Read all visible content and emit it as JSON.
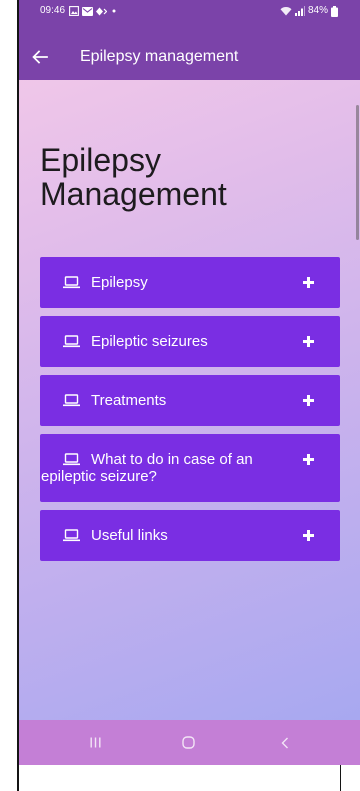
{
  "status_bar": {
    "time": "09:46",
    "battery_level": "84%",
    "left_icons": [
      "gallery-icon",
      "mail-icon",
      "status-app-icon",
      "dot-icon"
    ],
    "right_icons": [
      "wifi-icon",
      "signal-icon",
      "battery-icon"
    ]
  },
  "app_bar": {
    "back_icon": "arrow-left-icon",
    "title": "Epilepsy management"
  },
  "main": {
    "heading": "Epilepsy Management",
    "sections": [
      {
        "icon": "laptop-icon",
        "label": "Epilepsy",
        "toggle_icon": "plus-icon"
      },
      {
        "icon": "laptop-icon",
        "label": "Epileptic seizures",
        "toggle_icon": "plus-icon"
      },
      {
        "icon": "laptop-icon",
        "label": "Treatments",
        "toggle_icon": "plus-icon"
      },
      {
        "icon": "laptop-icon",
        "label": "What to do in case of an epileptic seizure?",
        "toggle_icon": "plus-icon"
      },
      {
        "icon": "laptop-icon",
        "label": "Useful links",
        "toggle_icon": "plus-icon"
      }
    ]
  },
  "nav_bar": {
    "icons": [
      "recents-icon",
      "home-icon",
      "back-icon"
    ]
  },
  "colors": {
    "app_bar": "#7b43a9",
    "section_button": "#7a2ee3",
    "section_text": "#ffffff",
    "heading_text": "#1d1b1e",
    "nav_bar": "#c47fd6",
    "background_gradient": [
      "#f6cbe8",
      "#e2bdea",
      "#c7b1ed",
      "#a3a7f1"
    ]
  }
}
